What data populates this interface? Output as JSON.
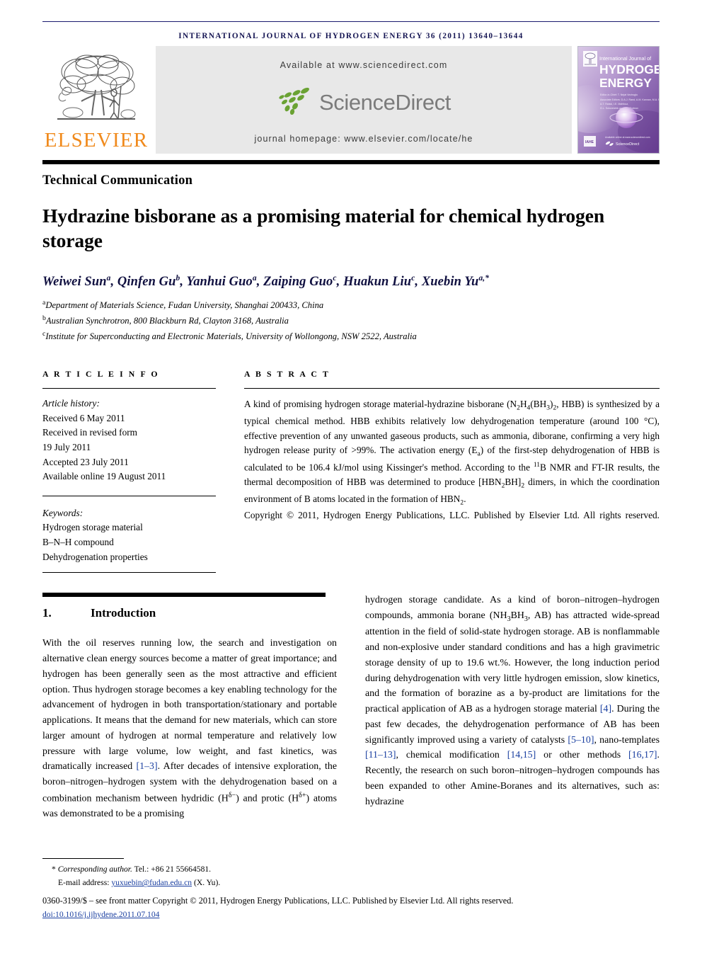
{
  "running_head": "International Journal of Hydrogen Energy 36 (2011) 13640–13644",
  "masthead": {
    "publisher_name": "ELSEVIER",
    "publisher_logo_icon": "elsevier-tree-icon",
    "available_at": "Available at www.sciencedirect.com",
    "sciencedirect_wordmark": "ScienceDirect",
    "sciencedirect_logo_icon": "sciencedirect-leaves-icon",
    "journal_homepage": "journal homepage: www.elsevier.com/locate/he",
    "cover": {
      "line1": "International Journal of",
      "line2": "HYDROGEN",
      "line3": "ENERGY",
      "editor_label": "Editor-in-Chief:",
      "editor_name": "T. Nejat Veziroğlu",
      "assoc_label": "Associate Editors:",
      "assoc_names": "D.A.J. Rand, A.M. Kannan, M.A. Rosen,\nA.T. Raissi, I.E. Mahfouz,\nG.L. Soloveichik and A.A. Portnov",
      "footer_note": "Available online at www.sciencedirect.com",
      "sd_label": "ScienceDirect",
      "badge": "IAHE"
    }
  },
  "article": {
    "doc_type": "Technical Communication",
    "title": "Hydrazine bisborane as a promising material for chemical hydrogen storage",
    "authors_html": "Weiwei Sun<sup>a</sup>, Qinfen Gu<sup>b</sup>, Yanhui Guo<sup>a</sup>, Zaiping Guo<sup>c</sup>, Huakun Liu<sup>c</sup>, Xuebin Yu<sup>a,*</sup>",
    "affiliations": [
      {
        "marker": "a",
        "text": "Department of Materials Science, Fudan University, Shanghai 200433, China"
      },
      {
        "marker": "b",
        "text": "Australian Synchrotron, 800 Blackburn Rd, Clayton 3168, Australia"
      },
      {
        "marker": "c",
        "text": "Institute for Superconducting and Electronic Materials, University of Wollongong, NSW 2522, Australia"
      }
    ]
  },
  "article_info": {
    "heading": "A R T I C L E   I N F O",
    "history_label": "Article history:",
    "history": [
      "Received 6 May 2011",
      "Received in revised form",
      "19 July 2011",
      "Accepted 23 July 2011",
      "Available online 19 August 2011"
    ],
    "keywords_label": "Keywords:",
    "keywords": [
      "Hydrogen storage material",
      "B–N–H compound",
      "Dehydrogenation properties"
    ]
  },
  "abstract": {
    "heading": "A B S T R A C T",
    "body_html": "A kind of promising hydrogen storage material-hydrazine bisborane (N<sub>2</sub>H<sub>4</sub>(BH<sub>3</sub>)<sub>2</sub>, HBB) is synthesized by a typical chemical method. HBB exhibits relatively low dehydrogenation temperature (around 100 °C), effective prevention of any unwanted gaseous products, such as ammonia, diborane, confirming a very high hydrogen release purity of &gt;99%. The activation energy (E<sub>a</sub>) of the first-step dehydrogenation of HBB is calculated to be 106.4 kJ/mol using Kissinger's method. According to the <sup>11</sup>B NMR and FT-IR results, the thermal decomposition of HBB was determined to produce [HBN<sub>2</sub>BH]<sub>2</sub> dimers, in which the coordination environment of B atoms located in the formation of HBN<sub>2</sub>.",
    "copyright": "Copyright © 2011, Hydrogen Energy Publications, LLC. Published by Elsevier Ltd. All rights reserved."
  },
  "section": {
    "number": "1.",
    "title": "Introduction",
    "left_column_html": "With the oil reserves running low, the search and investigation on alternative clean energy sources become a matter of great importance; and hydrogen has been generally seen as the most attractive and efficient option. Thus hydrogen storage becomes a key enabling technology for the advancement of hydrogen in both transportation/stationary and portable applications. It means that the demand for new materials, which can store larger amount of hydrogen at normal temperature and relatively low pressure with large volume, low weight, and fast kinetics, was dramatically increased <span class=\"ref\">[1–3]</span>. After decades of intensive exploration, the boron–nitrogen–hydrogen system with the dehydrogenation based on a combination mechanism between hydridic (H<sup>δ−</sup>) and protic (H<sup>δ+</sup>) atoms was demonstrated to be a promising",
    "right_column_html": "hydrogen storage candidate. As a kind of boron–nitrogen–hydrogen compounds, ammonia borane (NH<sub>3</sub>BH<sub>3</sub>, AB) has attracted wide-spread attention in the field of solid-state hydrogen storage. AB is nonflammable and non-explosive under standard conditions and has a high gravimetric storage density of up to 19.6 wt.%. However, the long induction period during dehydrogenation with very little hydrogen emission, slow kinetics, and the formation of borazine as a by-product are limitations for the practical application of AB as a hydrogen storage material <span class=\"ref\">[4]</span>. During the past few decades, the dehydrogenation performance of AB has been significantly improved using a variety of catalysts <span class=\"ref\">[5–10]</span>, nano-templates <span class=\"ref\">[11–13]</span>, chemical modification <span class=\"ref\">[14,15]</span> or other methods <span class=\"ref\">[16,17]</span>. Recently, the research on such boron–nitrogen–hydrogen compounds has been expanded to other Amine-Boranes and its alternatives, such as: hydrazine"
  },
  "footer": {
    "corresponding_html": "<span style=\"font-style:italic\">Corresponding author.</span> Tel.: +86 21 55664581.",
    "email_label": "E-mail address:",
    "email": "yuxuebin@fudan.edu.cn",
    "email_suffix": "(X. Yu).",
    "issn_line": "0360-3199/$ – see front matter Copyright © 2011, Hydrogen Energy Publications, LLC. Published by Elsevier Ltd. All rights reserved.",
    "doi": "doi:10.1016/j.ijhydene.2011.07.104"
  },
  "colors": {
    "elsevier_orange": "#f08a1c",
    "sciencedirect_green": "#6aa233",
    "sciencedirect_grey": "#7b7b7b",
    "link_blue": "#1a3fa0",
    "runhead_navy": "#141452",
    "author_navy": "#101040"
  }
}
